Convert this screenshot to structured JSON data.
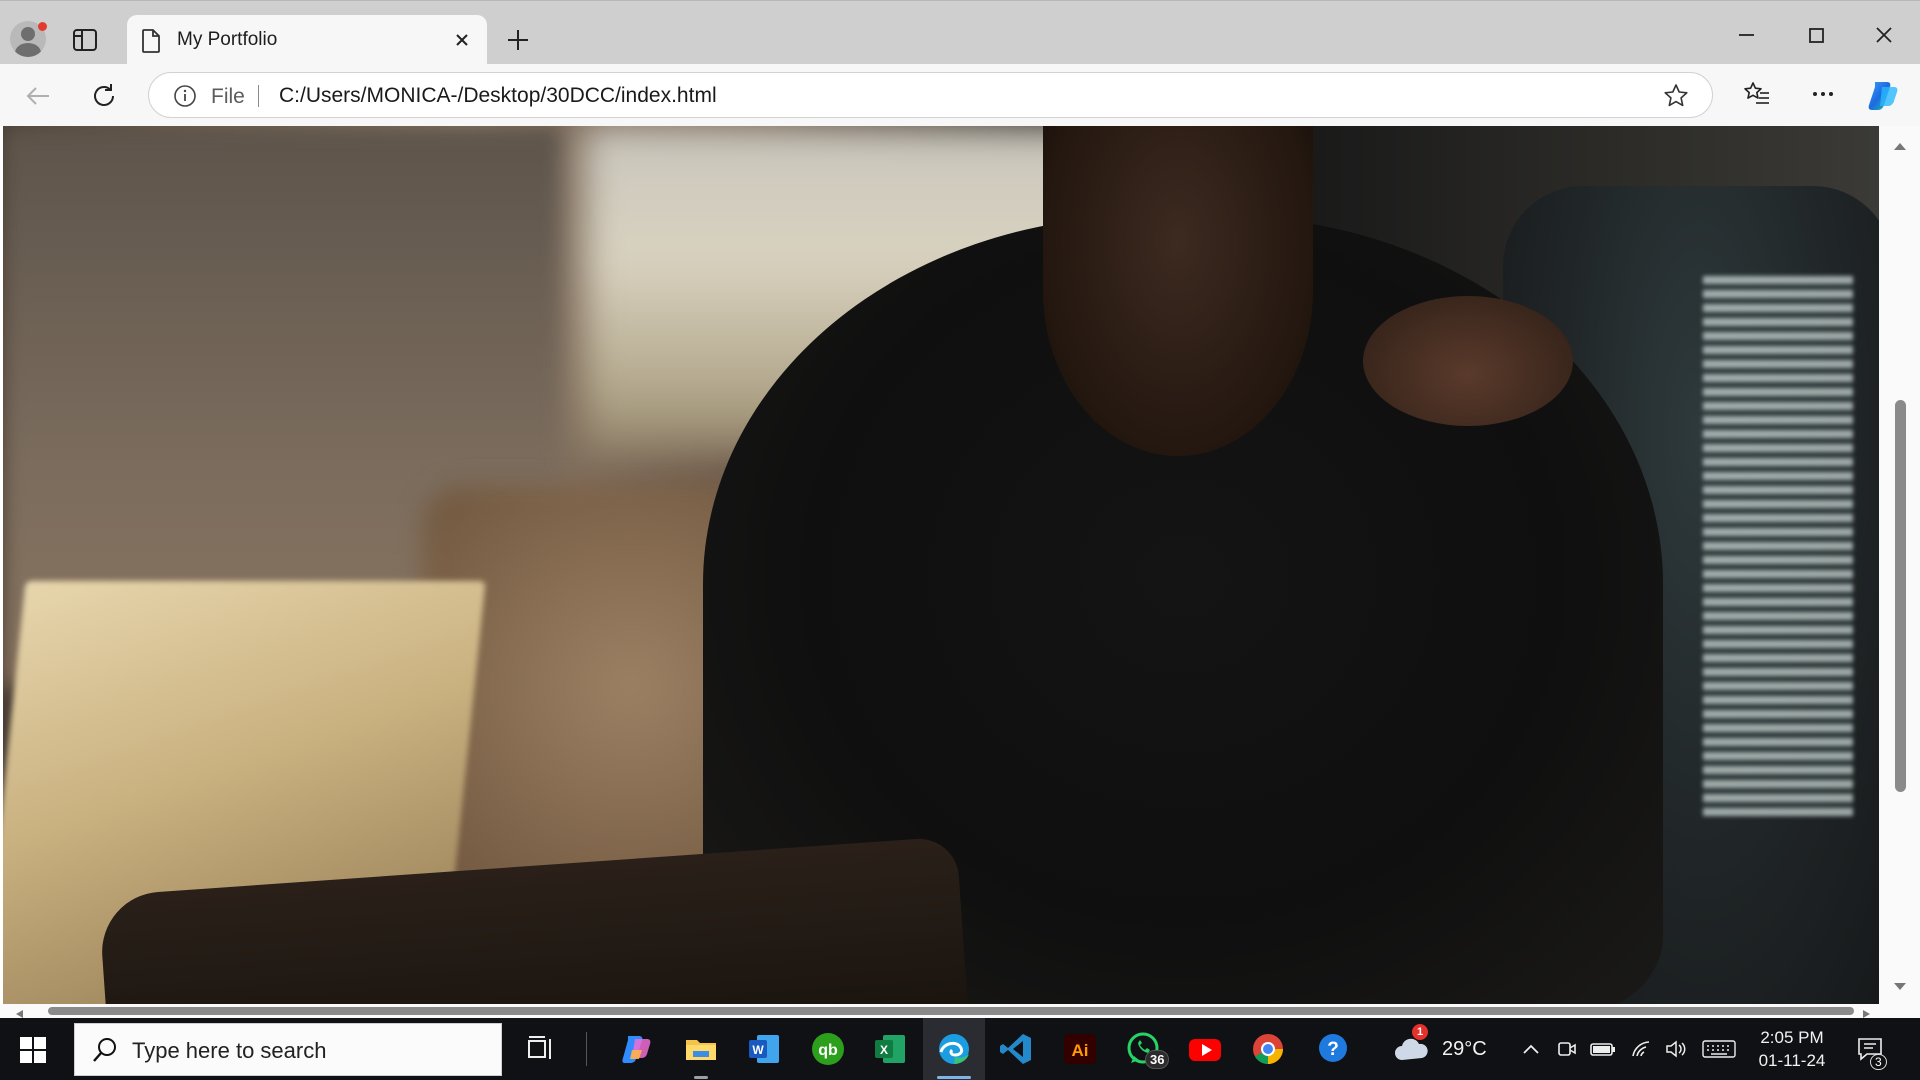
{
  "browser": {
    "tab": {
      "title": "My Portfolio"
    },
    "address": {
      "scheme_label": "File",
      "url": "C:/Users/MONICA-/Desktop/30DCC/index.html"
    },
    "icons": {
      "profile": "profile-avatar-icon",
      "tab_actions": "tab-actions-icon",
      "page": "document-icon",
      "close_tab": "close-icon",
      "new_tab": "plus-icon",
      "minimize": "minimize-icon",
      "maximize": "maximize-icon",
      "close_window": "close-window-icon",
      "back": "back-arrow-icon",
      "refresh": "refresh-icon",
      "info": "info-icon",
      "favorite": "star-icon",
      "favorites": "favorites-icon",
      "menu": "more-icon",
      "copilot": "copilot-icon"
    }
  },
  "page": {
    "hero_image": "photo of a person in a black top seated at a laptop"
  },
  "taskbar": {
    "search_placeholder": "Type here to search",
    "apps": [
      {
        "name": "task-view"
      },
      {
        "name": "copilot"
      },
      {
        "name": "file-explorer"
      },
      {
        "name": "word"
      },
      {
        "name": "quickbooks"
      },
      {
        "name": "excel"
      },
      {
        "name": "edge",
        "active": true
      },
      {
        "name": "vscode"
      },
      {
        "name": "illustrator",
        "label": "Ai"
      },
      {
        "name": "whatsapp",
        "badge": "36"
      },
      {
        "name": "youtube"
      },
      {
        "name": "chrome"
      },
      {
        "name": "help"
      }
    ],
    "weather": {
      "temperature": "29°C",
      "alert_count": "1"
    },
    "clock": {
      "time": "2:05 PM",
      "date": "01-11-24"
    },
    "notifications": {
      "count": "3"
    }
  },
  "colors": {
    "tabstrip_bg": "#cfcfcf",
    "toolbar_bg": "#f7f7f7",
    "taskbar_bg": "#101114",
    "accent": "#0078d4"
  }
}
